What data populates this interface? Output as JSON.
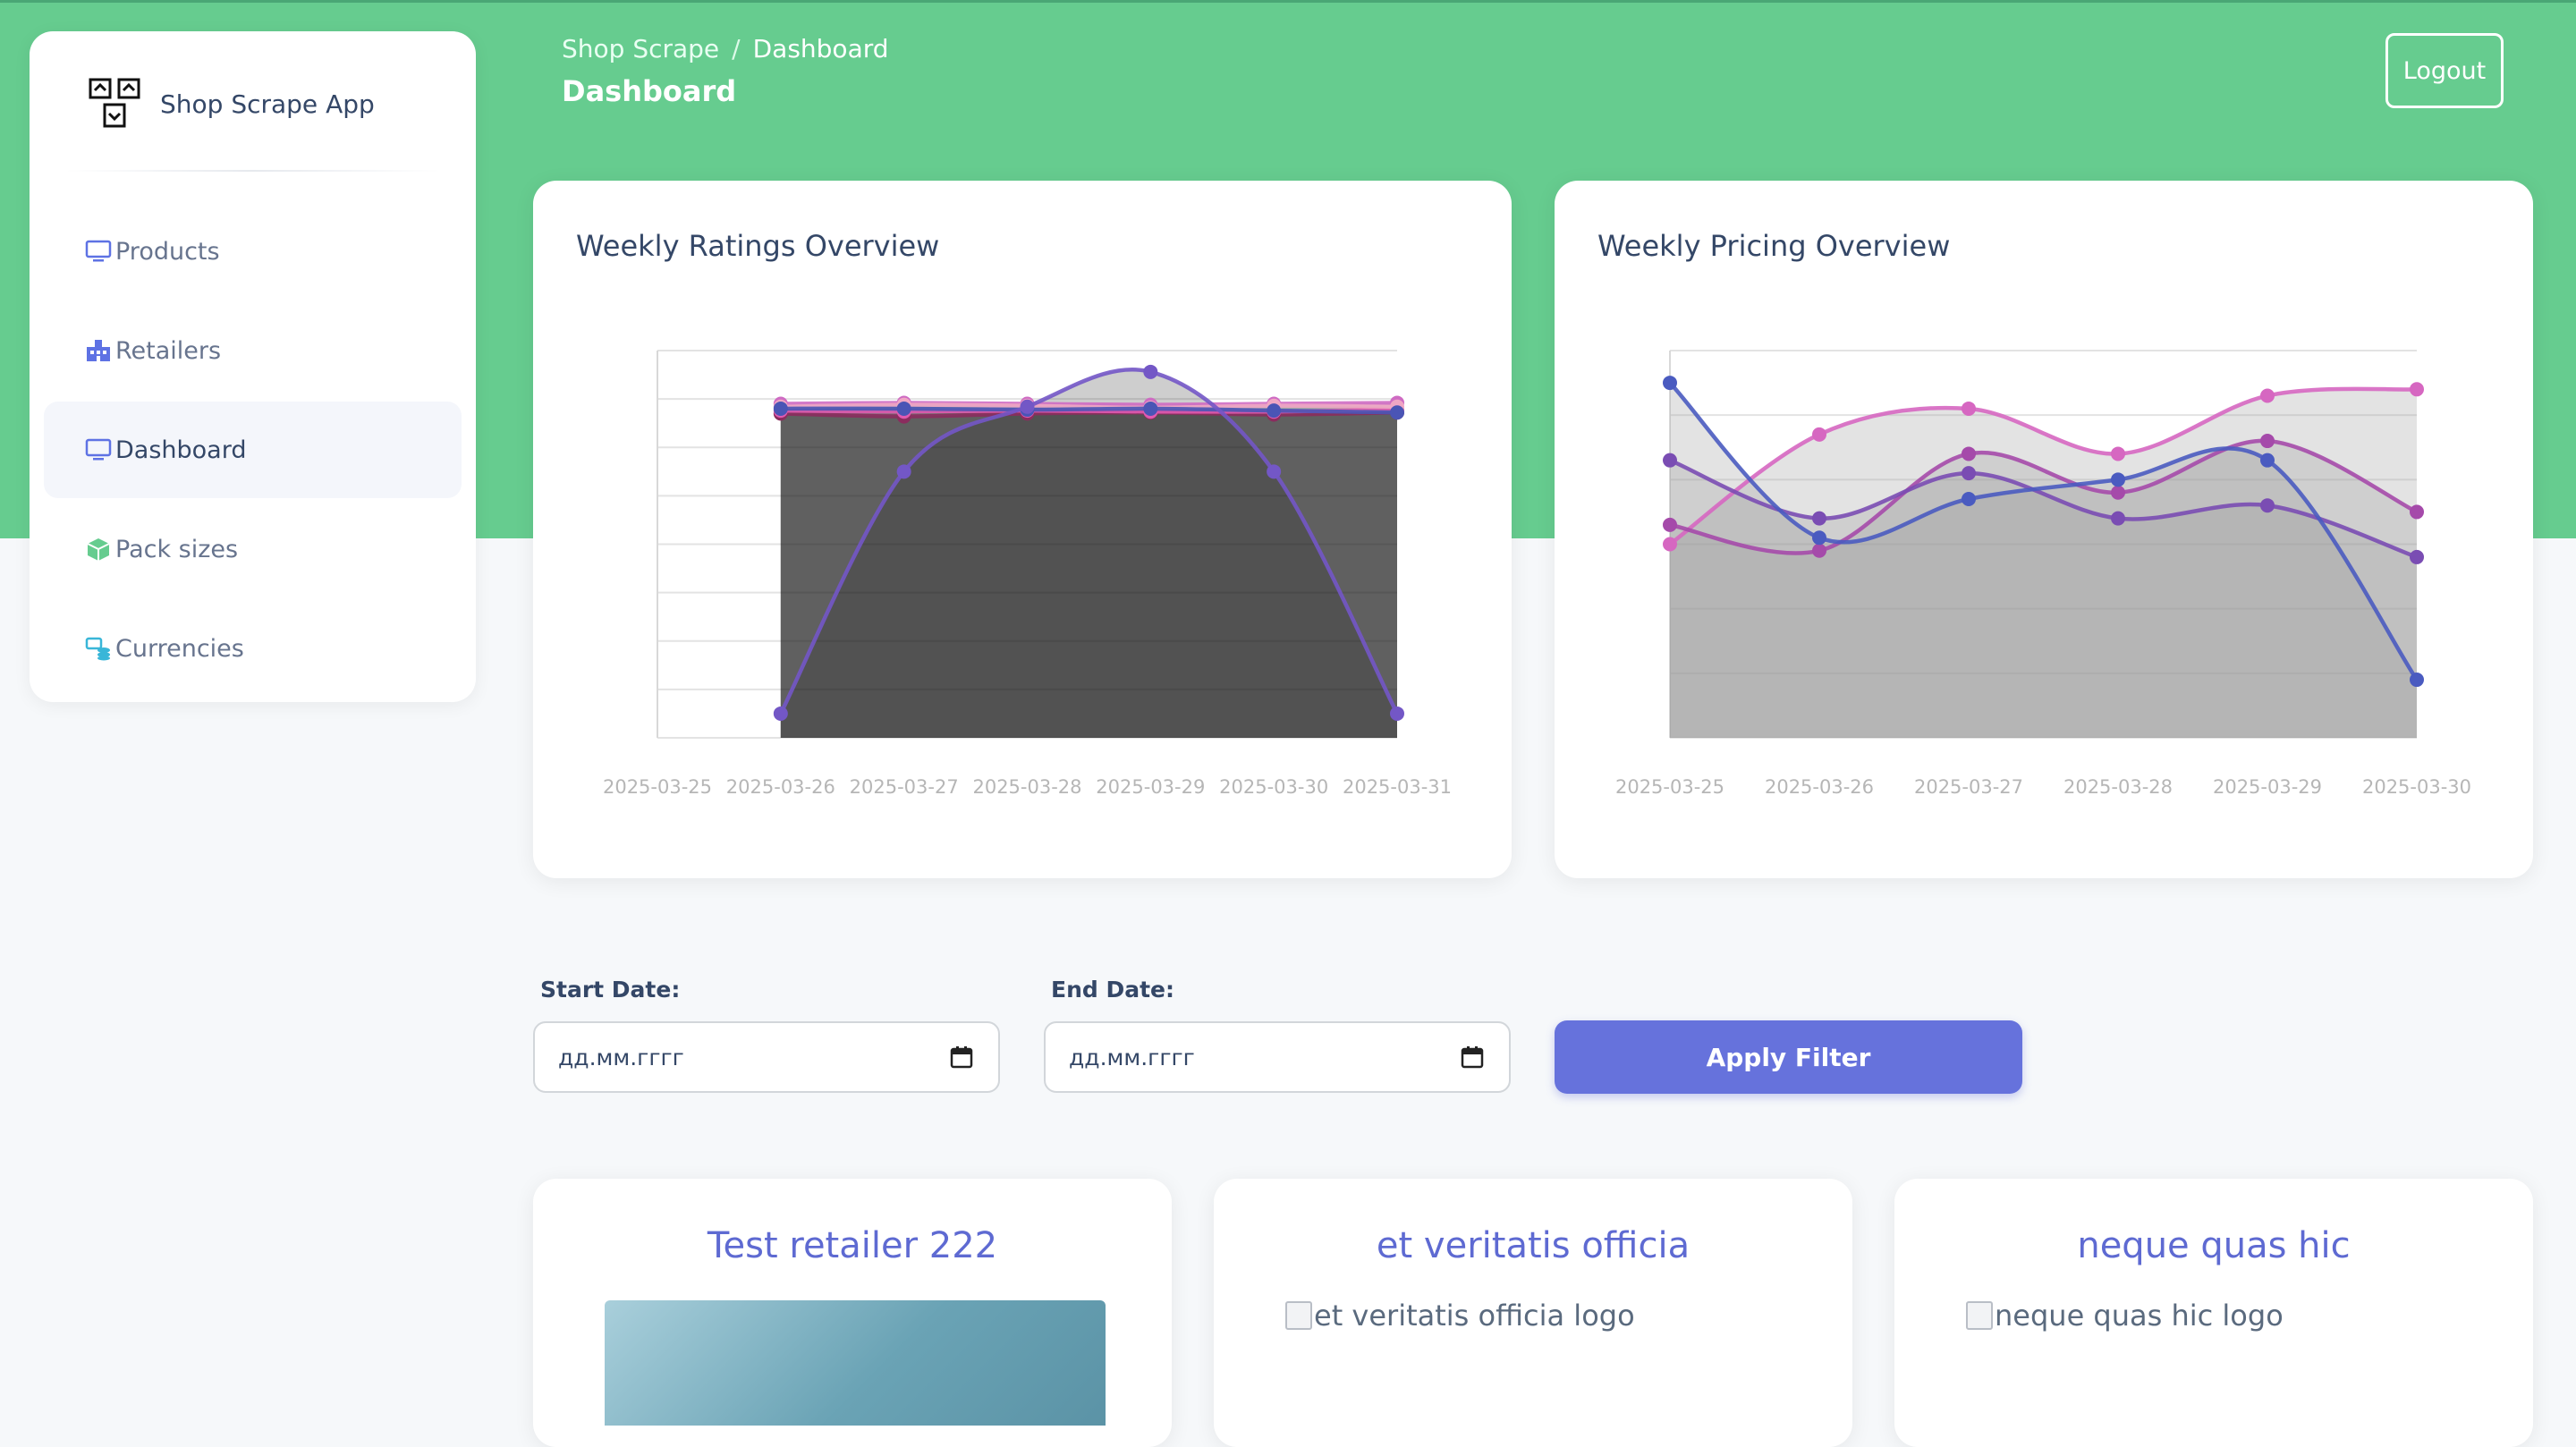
{
  "app": {
    "name": "Shop Scrape App"
  },
  "sidebar": {
    "items": [
      {
        "label": "Products",
        "icon": "monitor-icon"
      },
      {
        "label": "Retailers",
        "icon": "building-icon"
      },
      {
        "label": "Dashboard",
        "icon": "monitor-icon",
        "active": true
      },
      {
        "label": "Pack sizes",
        "icon": "box-icon"
      },
      {
        "label": "Currencies",
        "icon": "coins-icon"
      }
    ]
  },
  "header": {
    "breadcrumb": {
      "root": "Shop Scrape",
      "separator": "/",
      "current": "Dashboard"
    },
    "title": "Dashboard",
    "logout_label": "Logout"
  },
  "colors": {
    "accent_green": "#66cc8f",
    "primary": "#6672dc",
    "text_dark": "#344767"
  },
  "chart_data": [
    {
      "type": "line",
      "title": "Weekly Ratings Overview",
      "x": [
        "2025-03-25",
        "2025-03-26",
        "2025-03-27",
        "2025-03-28",
        "2025-03-29",
        "2025-03-30",
        "2025-03-31"
      ],
      "ylim": [
        0,
        4
      ],
      "area_fill": true,
      "series": [
        {
          "color": "#8b2c5e",
          "values": [
            null,
            3.35,
            3.32,
            3.35,
            3.36,
            3.34,
            3.36
          ]
        },
        {
          "color": "#e05ab0",
          "values": [
            null,
            3.38,
            3.37,
            3.38,
            3.37,
            3.37,
            3.39
          ]
        },
        {
          "color": "#cf6bc3",
          "values": [
            null,
            3.45,
            3.46,
            3.45,
            3.44,
            3.45,
            3.46
          ]
        },
        {
          "color": "#f0a6c4",
          "values": [
            null,
            3.42,
            3.44,
            3.43,
            3.41,
            3.43,
            3.42
          ]
        },
        {
          "color": "#4a55b5",
          "values": [
            null,
            3.4,
            3.4,
            3.39,
            3.4,
            3.38,
            3.36
          ]
        },
        {
          "color": "#7357c6",
          "values": [
            null,
            0.25,
            2.75,
            3.42,
            3.78,
            2.75,
            0.25
          ]
        }
      ]
    },
    {
      "type": "line",
      "title": "Weekly Pricing Overview",
      "x": [
        "2025-03-25",
        "2025-03-26",
        "2025-03-27",
        "2025-03-28",
        "2025-03-29",
        "2025-03-30"
      ],
      "ylim": [
        0,
        6
      ],
      "area_fill": true,
      "series": [
        {
          "color": "#d667c1",
          "values": [
            3.0,
            4.7,
            5.1,
            4.4,
            5.3,
            5.4
          ]
        },
        {
          "color": "#a54aaa",
          "values": [
            3.3,
            2.9,
            4.4,
            3.8,
            4.6,
            3.5
          ]
        },
        {
          "color": "#7a4db3",
          "values": [
            4.3,
            3.4,
            4.1,
            3.4,
            3.6,
            2.8
          ]
        },
        {
          "color": "#4a5bc0",
          "values": [
            5.5,
            3.1,
            3.7,
            4.0,
            4.3,
            0.9
          ]
        }
      ]
    }
  ],
  "filters": {
    "start_label": "Start Date:",
    "end_label": "End Date:",
    "start_value": "дд.мм.гггг",
    "end_value": "дд.мм.гггг",
    "apply_label": "Apply Filter"
  },
  "retailers": [
    {
      "name": "Test retailer 222",
      "image_alt": ""
    },
    {
      "name": "et veritatis officia",
      "image_alt": "et veritatis officia logo"
    },
    {
      "name": "neque quas hic",
      "image_alt": "neque quas hic logo"
    }
  ]
}
